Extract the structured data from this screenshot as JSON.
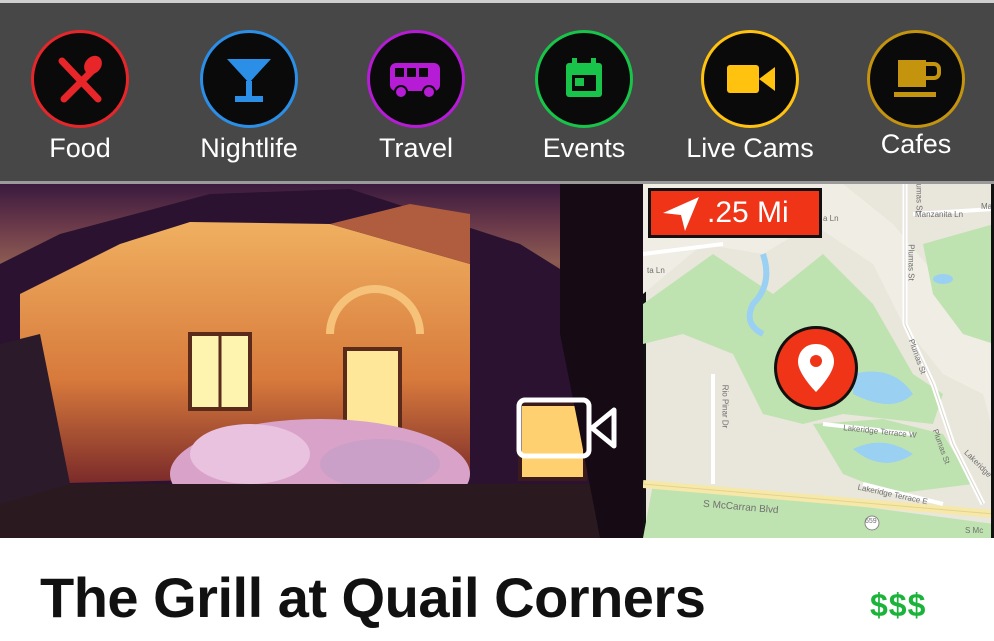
{
  "categories": [
    {
      "label": "Food",
      "icon": "fork-spoon-icon",
      "color": "#e8262a"
    },
    {
      "label": "Nightlife",
      "icon": "cocktail-icon",
      "color": "#2b8fe8"
    },
    {
      "label": "Travel",
      "icon": "van-icon",
      "color": "#b61bd6"
    },
    {
      "label": "Events",
      "icon": "calendar-icon",
      "color": "#18c44a"
    },
    {
      "label": "Live Cams",
      "icon": "video-camera-icon",
      "color": "#ffc20e"
    },
    {
      "label": "Cafes",
      "icon": "coffee-cup-icon",
      "color": "#c4940f"
    }
  ],
  "distance": {
    "label": ".25 Mi",
    "icon": "navigation-arrow-icon"
  },
  "map": {
    "streets": [
      "Plumas St",
      "Manzanita Ln",
      "Ma",
      "a Ln",
      "ta Ln",
      "Plumas St",
      "Plumas St",
      "Rio Pinar Dr",
      "Lakeridge Terrace W",
      "Plumas St",
      "Lakeridge Terrace E",
      "Lakeridge Terrace E",
      "S McCarran Blvd",
      "659",
      "S Mc"
    ]
  },
  "live_cam_icon": "video-camera-outline-icon",
  "map_pin_icon": "map-pin-icon",
  "venue": {
    "name": "The Grill at Quail Corners",
    "price": "$$$"
  }
}
